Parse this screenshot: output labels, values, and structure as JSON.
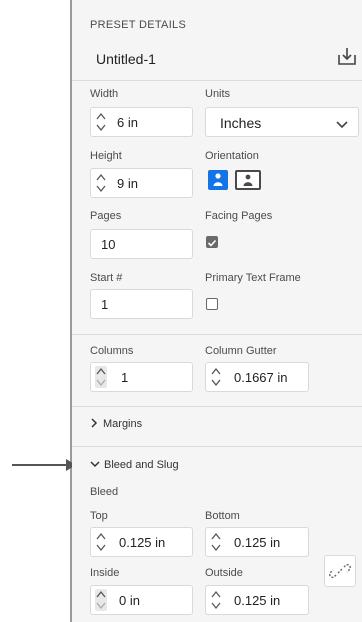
{
  "preset": {
    "section_title": "PRESET DETAILS",
    "name": "Untitled-1",
    "save_icon": "save-preset-icon"
  },
  "width": {
    "label": "Width",
    "value": "6 in"
  },
  "units": {
    "label": "Units",
    "value": "Inches"
  },
  "height": {
    "label": "Height",
    "value": "9 in"
  },
  "orientation": {
    "label": "Orientation",
    "selected": "portrait"
  },
  "pages": {
    "label": "Pages",
    "value": "10"
  },
  "facing_pages": {
    "label": "Facing Pages",
    "checked": true
  },
  "start": {
    "label": "Start #",
    "value": "1"
  },
  "primary_text_frame": {
    "label": "Primary Text Frame",
    "checked": false
  },
  "columns": {
    "label": "Columns",
    "value": "1"
  },
  "column_gutter": {
    "label": "Column Gutter",
    "value": "0.1667 in"
  },
  "margins": {
    "label": "Margins",
    "expanded": false
  },
  "bleed_slug": {
    "label": "Bleed and Slug",
    "expanded": true
  },
  "bleed": {
    "label": "Bleed",
    "top": {
      "label": "Top",
      "value": "0.125 in"
    },
    "bottom": {
      "label": "Bottom",
      "value": "0.125 in"
    },
    "inside": {
      "label": "Inside",
      "value": "0 in"
    },
    "outside": {
      "label": "Outside",
      "value": "0.125 in"
    },
    "link_icon": "unlinked-chain-icon"
  },
  "colors": {
    "accent": "#1473e6",
    "panel_bg": "#f5f5f5"
  }
}
